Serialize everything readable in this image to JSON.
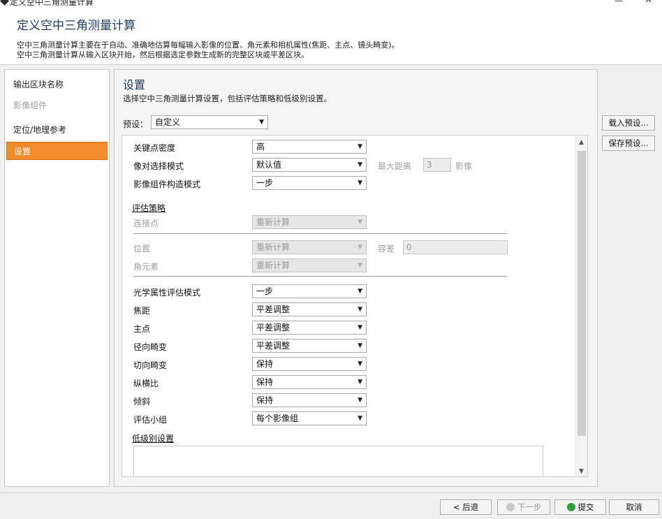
{
  "window": {
    "title": "定义空中三角测量计算",
    "minimize": "—",
    "close": "✕"
  },
  "header": {
    "title": "定义空中三角测量计算",
    "desc1": "空中三角测量计算主要在于自动、准确地估算每幅输入影像的位置、角元素和相机属性(焦距、主点、镜头畸变)。",
    "desc2": "空中三角测量计算从输入区块开始，然后根据选定参数生成新的完整区块或平差区块。"
  },
  "sidebar": {
    "items": [
      {
        "label": "输出区块名称",
        "state": "normal"
      },
      {
        "label": "影像组件",
        "state": "disabled"
      },
      {
        "label": "定位/地理参考",
        "state": "normal"
      },
      {
        "label": "设置",
        "state": "active"
      }
    ]
  },
  "main": {
    "title": "设置",
    "desc": "选择空中三角测量计算设置，包括评估策略和低级别设置。",
    "preset_label": "预设：",
    "preset_value": "自定义",
    "load_preset": "载入预设...",
    "save_preset": "保存预设..."
  },
  "settings": {
    "keypoint_density": {
      "label": "关键点密度",
      "value": "高"
    },
    "pair_selection": {
      "label": "像对选择模式",
      "value": "默认值",
      "max_dist_label": "最大距离",
      "max_dist_value": "3",
      "max_dist_unit": "影像"
    },
    "component_mode": {
      "label": "影像组件构造模式",
      "value": "一步"
    },
    "estimation_section": "评估策略",
    "tie_points": {
      "label": "连接点",
      "value": "重新计算"
    },
    "position": {
      "label": "位置",
      "value": "重新计算",
      "tolerance_label": "容差",
      "tolerance_value": "0"
    },
    "rotation": {
      "label": "角元素",
      "value": "重新计算"
    },
    "optical_mode": {
      "label": "光学属性评估模式",
      "value": "一步"
    },
    "focal_length": {
      "label": "焦距",
      "value": "平差调整"
    },
    "principal_point": {
      "label": "主点",
      "value": "平差调整"
    },
    "radial_distortion": {
      "label": "径向畸变",
      "value": "平差调整"
    },
    "tangential_distortion": {
      "label": "切向畸变",
      "value": "保持"
    },
    "aspect_ratio": {
      "label": "纵横比",
      "value": "保持"
    },
    "skew": {
      "label": "倾斜",
      "value": "保持"
    },
    "estimation_group": {
      "label": "评估小组",
      "value": "每个影像组"
    },
    "low_level_section": "低级别设置"
  },
  "footer": {
    "back": "< 后退",
    "next": "下一步",
    "submit": "提交",
    "cancel": "取消"
  },
  "icons": {
    "dropdown": "chevron-down-icon",
    "scroll_up": "scroll-up-icon",
    "scroll_down": "scroll-down-icon"
  }
}
